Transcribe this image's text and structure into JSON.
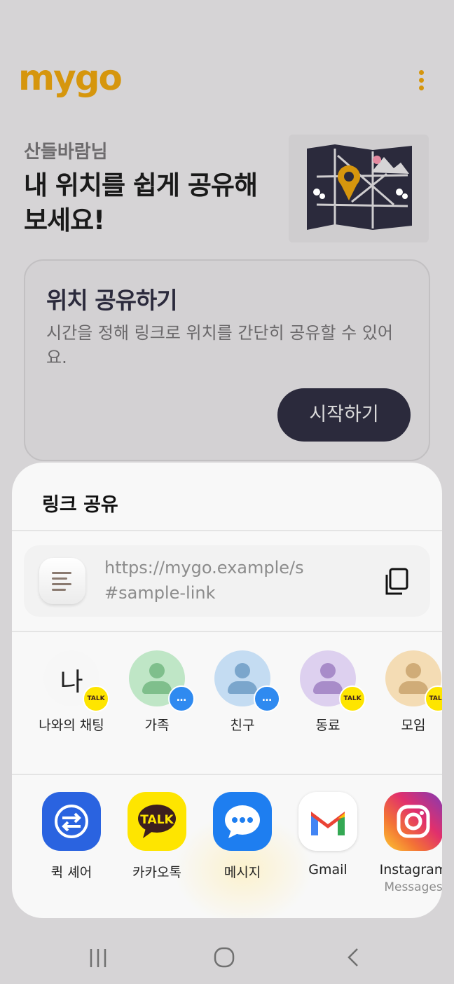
{
  "app": {
    "logo": "mygo",
    "greeting_name": "산들바람님",
    "greeting_title": "내 위치를 쉽게 공유해보세요!",
    "card": {
      "title": "위치 공유하기",
      "description": "시간을 정해 링크로 위치를 간단히 공유할 수 있어요.",
      "button": "시작하기"
    },
    "colors": {
      "brand": "#d6960d",
      "primary_dark": "#2b2a3c"
    }
  },
  "share_sheet": {
    "title": "링크 공유",
    "link": "https://mygo.example/s#sample-link",
    "contacts": [
      {
        "label": "나와의 채팅",
        "avatar_text": "나",
        "badge": "TALK",
        "badge_type": "kakao"
      },
      {
        "label": "가족",
        "badge": "…",
        "badge_type": "msg",
        "avatar_color": "#bfe6c6",
        "figure_color": "#7fbf8c"
      },
      {
        "label": "친구",
        "badge": "…",
        "badge_type": "msg",
        "avatar_color": "#c4dcf2",
        "figure_color": "#7ba6cc"
      },
      {
        "label": "동료",
        "badge": "TALK",
        "badge_type": "kakao",
        "avatar_color": "#ddd0ef",
        "figure_color": "#a88cc9"
      },
      {
        "label": "모임",
        "badge": "TALK",
        "badge_type": "kakao",
        "avatar_color": "#f4dcb4",
        "figure_color": "#d0ac78"
      }
    ],
    "apps": [
      {
        "label": "퀵 셰어",
        "sub": "",
        "icon": "quick-share-icon"
      },
      {
        "label": "카카오톡",
        "sub": "",
        "icon": "kakaotalk-icon",
        "icon_text": "TALK"
      },
      {
        "label": "메시지",
        "sub": "",
        "icon": "messages-icon"
      },
      {
        "label": "Gmail",
        "sub": "",
        "icon": "gmail-icon"
      },
      {
        "label": "Instagram",
        "sub": "Messages",
        "icon": "instagram-icon"
      }
    ]
  }
}
